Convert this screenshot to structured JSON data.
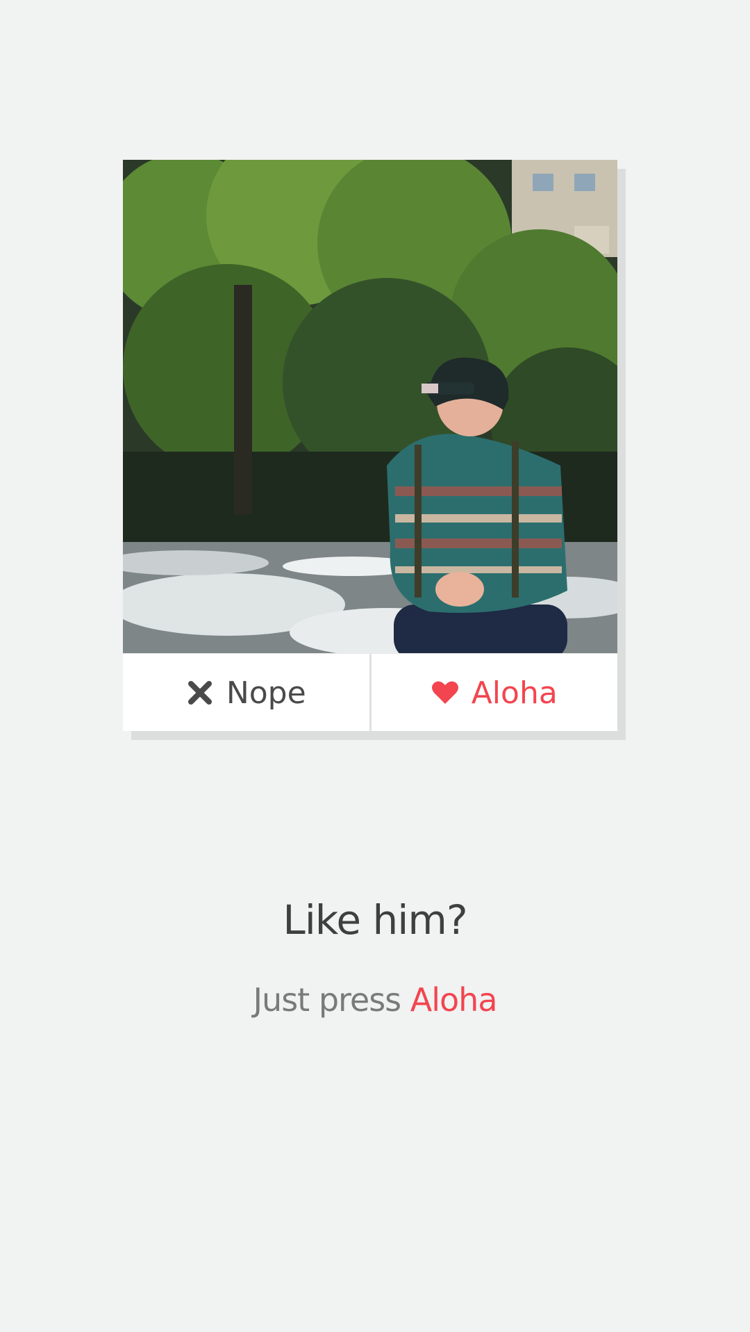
{
  "card": {
    "photo_alt": "Smiling young man in a beanie and patterned shirt sitting by a river",
    "nope_label": "Nope",
    "aloha_label": "Aloha",
    "nope_icon": "close-icon",
    "aloha_icon": "heart-icon"
  },
  "prompt": {
    "title": "Like him?",
    "hint_prefix": "Just press ",
    "hint_accent": "Aloha"
  },
  "colors": {
    "accent": "#f2454f",
    "text_dark": "#3f3f3f",
    "background": "#f1f2f2"
  }
}
